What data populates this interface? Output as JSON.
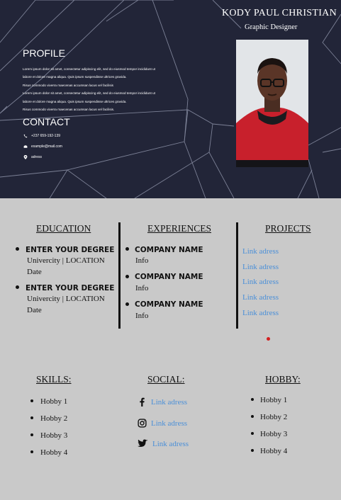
{
  "header": {
    "name": "KODY PAUL CHRISTIAN",
    "role": "Graphic Designer",
    "profile_title": "PROFILE",
    "profile_lines": [
      "Lorem ipsum dolor sit amet, consectetur adipiscing elit, sed do eiusmod tempor incididunt ut",
      "labore et dolore magna aliqua. Quis ipsum suspendisse ultrices gravida.",
      "Risus commodo viverra maecenas accumsan lacus vel facilisis",
      "Lorem ipsum dolor sit amet, consectetur adipiscing elit, sed do eiusmod tempor incididunt ut",
      "labore et dolore magna aliqua. Quis ipsum suspendisse ultrices gravida.",
      "Risus commodo viverra maecenas accumsan lacus vel facilisis."
    ],
    "contact_title": "CONTACT",
    "contact": {
      "phone": "+237 659-192-139",
      "email": "example@mail.com",
      "address": "adress"
    }
  },
  "education": {
    "title": "EDUCATION",
    "items": [
      {
        "degree": "ENTER YOUR DEGREE",
        "place": "Univercity | LOCATION",
        "date": "Date"
      },
      {
        "degree": "ENTER YOUR DEGREE",
        "place": "Univercity | LOCATION",
        "date": "Date"
      }
    ]
  },
  "experiences": {
    "title": "EXPERIENCES",
    "items": [
      {
        "company": "COMPANY NAME",
        "info": "Info"
      },
      {
        "company": "COMPANY NAME",
        "info": "Info"
      },
      {
        "company": "COMPANY NAME",
        "info": "Info"
      }
    ]
  },
  "projects": {
    "title": "PROJECTS",
    "links": [
      "Link adress",
      "Link adress",
      "Link adress",
      "Link adress",
      "Link adress"
    ]
  },
  "skills": {
    "title": "SKILLS:",
    "items": [
      "Hobby 1",
      "Hobby 2",
      "Hobby 3",
      "Hobby 4"
    ]
  },
  "social": {
    "title": "SOCIAL:",
    "items": [
      {
        "icon": "facebook-icon",
        "label": "Link adress"
      },
      {
        "icon": "instagram-icon",
        "label": "Link adress"
      },
      {
        "icon": "twitter-icon",
        "label": "Link adress"
      }
    ]
  },
  "hobby": {
    "title": "HOBBY:",
    "items": [
      "Hobby 1",
      "Hobby 2",
      "Hobby 3",
      "Hobby 4"
    ]
  },
  "colors": {
    "header_bg": "#222538",
    "body_bg": "#c9c9c9",
    "link": "#4a8fd8",
    "accent_dot": "#d42020"
  }
}
